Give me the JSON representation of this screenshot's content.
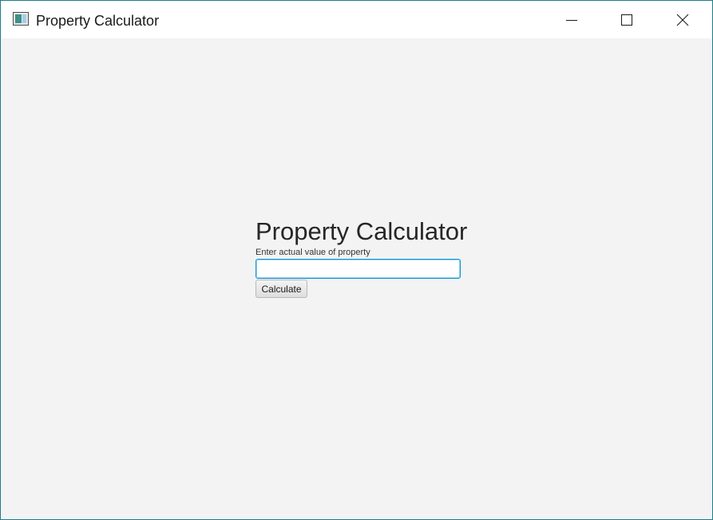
{
  "window": {
    "title": "Property Calculator",
    "app_icon": "app-window-icon",
    "controls": {
      "minimize": "minimize-icon",
      "maximize": "maximize-icon",
      "close": "close-icon"
    }
  },
  "form": {
    "heading": "Property Calculator",
    "value_label": "Enter actual value of property",
    "value_input": {
      "value": "",
      "placeholder": ""
    },
    "calculate_label": "Calculate"
  },
  "colors": {
    "window_border": "#1e7d8c",
    "client_background": "#f3f3f3",
    "input_focus_border": "#0a96d6"
  }
}
